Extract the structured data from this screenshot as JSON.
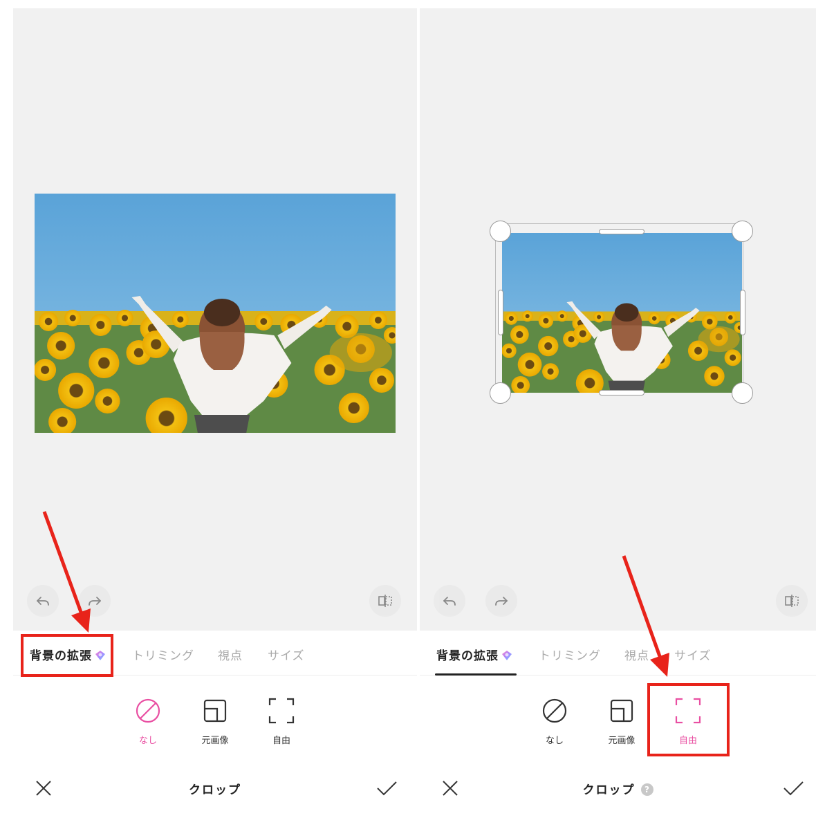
{
  "left": {
    "tabs": [
      "背景の拡張",
      "トリミング",
      "視点",
      "サイズ"
    ],
    "options": [
      {
        "label": "なし",
        "icon": "none-icon",
        "selected": true
      },
      {
        "label": "元画像",
        "icon": "original-ratio-icon",
        "selected": false
      },
      {
        "label": "自由",
        "icon": "free-crop-icon",
        "selected": false
      }
    ],
    "footer_title": "クロップ"
  },
  "right": {
    "tabs": [
      "背景の拡張",
      "トリミング",
      "視点",
      "サイズ"
    ],
    "options": [
      {
        "label": "なし",
        "icon": "none-icon",
        "selected": false
      },
      {
        "label": "元画像",
        "icon": "original-ratio-icon",
        "selected": false
      },
      {
        "label": "自由",
        "icon": "free-crop-icon",
        "selected": true
      }
    ],
    "footer_title": "クロップ",
    "help_mark": "?"
  },
  "colors": {
    "accent": "#e94fa2",
    "annotation_red": "#e8231a",
    "canvas_bg": "#f1f1f1"
  }
}
